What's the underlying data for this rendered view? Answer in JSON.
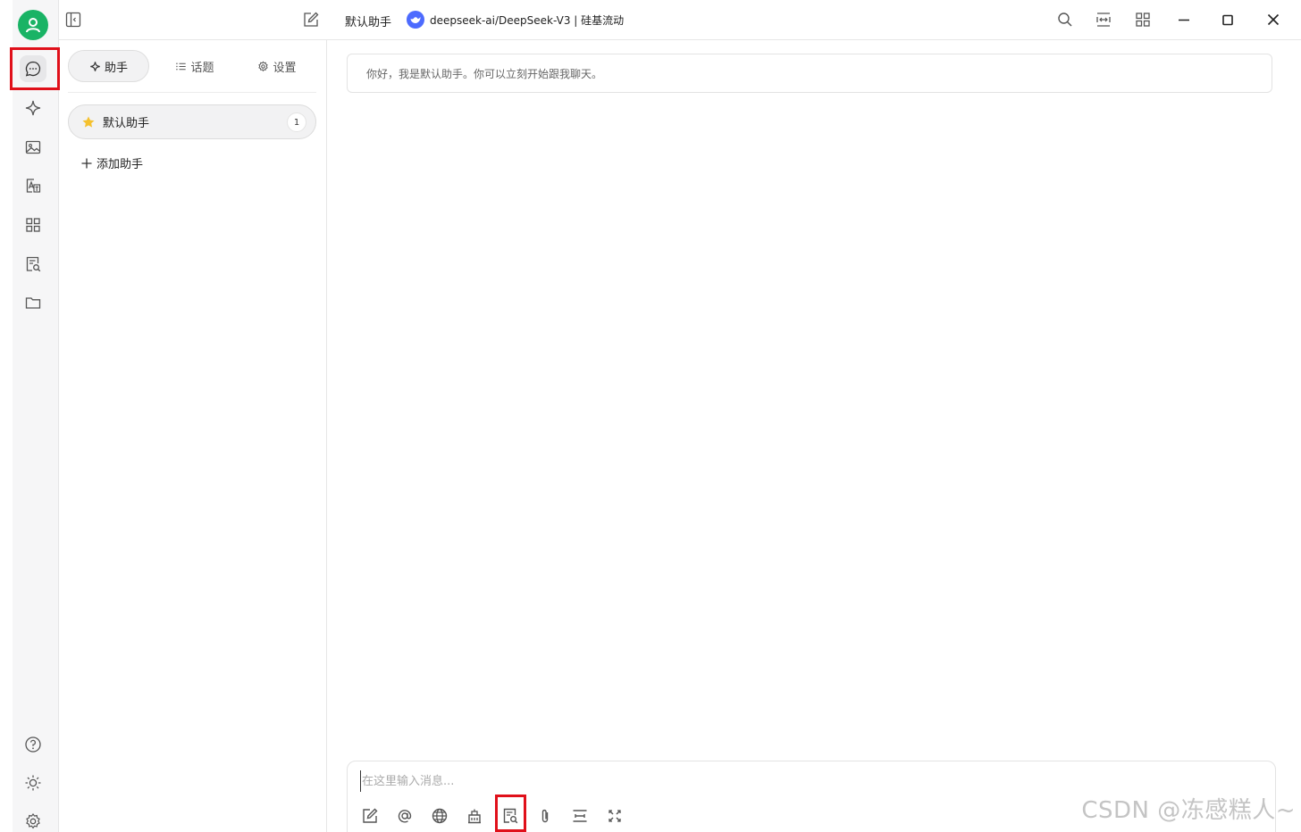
{
  "header": {
    "assistant_name": "默认助手",
    "model_name": "deepseek-ai/DeepSeek-V3 | 硅基流动"
  },
  "rail": {
    "items": [
      "chat-icon",
      "sparkle-icon",
      "image-icon",
      "translate-icon",
      "apps-icon",
      "knowledge-icon",
      "folder-icon"
    ],
    "bottom": [
      "help-icon",
      "theme-sun-icon",
      "settings-icon"
    ]
  },
  "panel": {
    "tabs": [
      {
        "label": "助手",
        "icon": "sparkle-icon",
        "active": true
      },
      {
        "label": "话题",
        "icon": "list-icon",
        "active": false
      },
      {
        "label": "设置",
        "icon": "gear-icon",
        "active": false
      }
    ],
    "assistants": [
      {
        "name": "默认助手",
        "icon": "star-emoji",
        "count": "1"
      }
    ],
    "add_label": "添加助手"
  },
  "chat": {
    "greeting": "你好，我是默认助手。你可以立刻开始跟我聊天。",
    "input_placeholder": "在这里输入消息...",
    "tools": [
      "new-topic-icon",
      "mention-icon",
      "web-search-icon",
      "knowledge-base-icon",
      "knowledge-search-icon",
      "attachment-icon",
      "clear-context-icon",
      "expand-icon"
    ]
  },
  "watermark": "CSDN @冻感糕人~",
  "colors": {
    "highlight": "#e0101a",
    "avatar": "#19b365",
    "model_logo": "#4d6bfe",
    "star": "#f5c12e"
  }
}
